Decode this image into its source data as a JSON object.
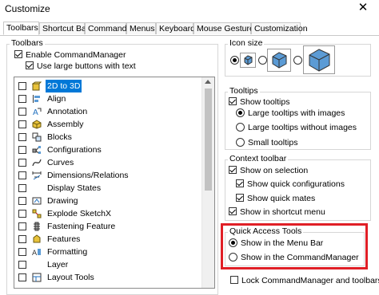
{
  "window": {
    "title": "Customize",
    "close_glyph": "✕"
  },
  "tabs": [
    {
      "label": "Toolbars",
      "active": true
    },
    {
      "label": "Shortcut Bars"
    },
    {
      "label": "Commands"
    },
    {
      "label": "Menus"
    },
    {
      "label": "Keyboard"
    },
    {
      "label": "Mouse Gestures"
    },
    {
      "label": "Customization"
    }
  ],
  "toolbars": {
    "group_label": "Toolbars",
    "enable_command_manager": {
      "label": "Enable CommandManager",
      "checked": true
    },
    "use_large_buttons": {
      "label": "Use large buttons with text",
      "checked": true
    },
    "items": [
      {
        "label": "2D to 3D",
        "icon": "2d-to-3d-icon",
        "checked": false,
        "selected": true
      },
      {
        "label": "Align",
        "icon": "align-icon",
        "checked": false
      },
      {
        "label": "Annotation",
        "icon": "annotation-icon",
        "checked": false
      },
      {
        "label": "Assembly",
        "icon": "assembly-icon",
        "checked": false
      },
      {
        "label": "Blocks",
        "icon": "blocks-icon",
        "checked": false
      },
      {
        "label": "Configurations",
        "icon": "configurations-icon",
        "checked": false
      },
      {
        "label": "Curves",
        "icon": "curves-icon",
        "checked": false
      },
      {
        "label": "Dimensions/Relations",
        "icon": "dimensions-icon",
        "checked": false
      },
      {
        "label": "Display States",
        "icon": "",
        "checked": false
      },
      {
        "label": "Drawing",
        "icon": "drawing-icon",
        "checked": false
      },
      {
        "label": "Explode SketchX",
        "icon": "explode-sketch-icon",
        "checked": false
      },
      {
        "label": "Fastening Feature",
        "icon": "fastening-feature-icon",
        "checked": false
      },
      {
        "label": "Features",
        "icon": "features-icon",
        "checked": false
      },
      {
        "label": "Formatting",
        "icon": "formatting-icon",
        "checked": false
      },
      {
        "label": "Layer",
        "icon": "",
        "checked": false
      },
      {
        "label": "Layout Tools",
        "icon": "layout-tools-icon",
        "checked": false
      }
    ]
  },
  "icon_size": {
    "group_label": "Icon size",
    "options": [
      "small",
      "medium",
      "large"
    ],
    "selected": "small"
  },
  "tooltips": {
    "group_label": "Tooltips",
    "show_tooltips": {
      "label": "Show tooltips",
      "checked": true
    },
    "options": [
      {
        "label": "Large tooltips with images",
        "selected": true
      },
      {
        "label": "Large tooltips without images",
        "selected": false
      },
      {
        "label": "Small tooltips",
        "selected": false
      }
    ]
  },
  "context_toolbar": {
    "group_label": "Context toolbar",
    "show_on_selection": {
      "label": "Show on selection",
      "checked": true
    },
    "show_quick_configurations": {
      "label": "Show quick configurations",
      "checked": true
    },
    "show_quick_mates": {
      "label": "Show quick mates",
      "checked": true
    },
    "show_in_shortcut_menu": {
      "label": "Show in shortcut menu",
      "checked": true
    }
  },
  "quick_access_tools": {
    "group_label": "Quick Access Tools",
    "options": [
      {
        "label": "Show in the Menu Bar",
        "selected": true
      },
      {
        "label": "Show in the CommandManager",
        "selected": false
      }
    ]
  },
  "lock_command_manager": {
    "label": "Lock CommandManager and toolbars",
    "checked": false
  },
  "colors": {
    "highlight": "#e01f26",
    "selection": "#0078d7"
  }
}
